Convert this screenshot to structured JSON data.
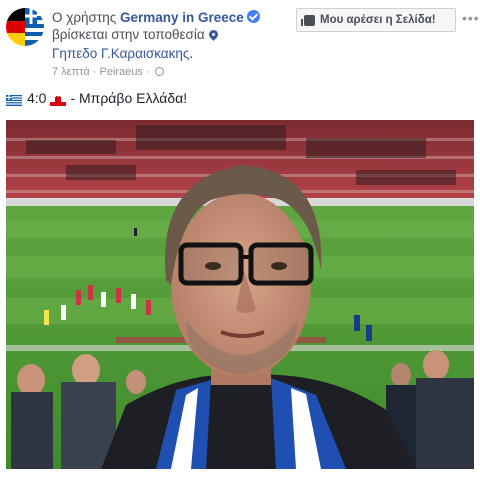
{
  "header": {
    "prefix": "Ο χρήστης",
    "page_name": "Germany in Greece",
    "location_text": "βρίσκεται στην τοποθεσία",
    "place": "Γηπεδο Γ.Καραισκακης",
    "place_suffix": ".",
    "time": "7 λεπτά",
    "separator": "·",
    "city": "Peiraeus",
    "separator2": "·"
  },
  "like_page_button": {
    "label": "Μου αρέσει η Σελίδα!"
  },
  "more_button": {
    "label": "•••"
  },
  "post": {
    "score": "4:0",
    "message": "- Μπράβο Ελλάδα!"
  },
  "icons": {
    "verified": "verified-badge-icon",
    "pin": "location-pin-icon",
    "globe": "globe-icon",
    "thumb": "thumbs-up-icon",
    "flag_greece": "greece-flag-icon",
    "flag_gibraltar": "gibraltar-flag-icon"
  },
  "colors": {
    "link": "#365899",
    "meta": "#90949c",
    "text": "#1d2129",
    "verified": "#4080ff"
  }
}
